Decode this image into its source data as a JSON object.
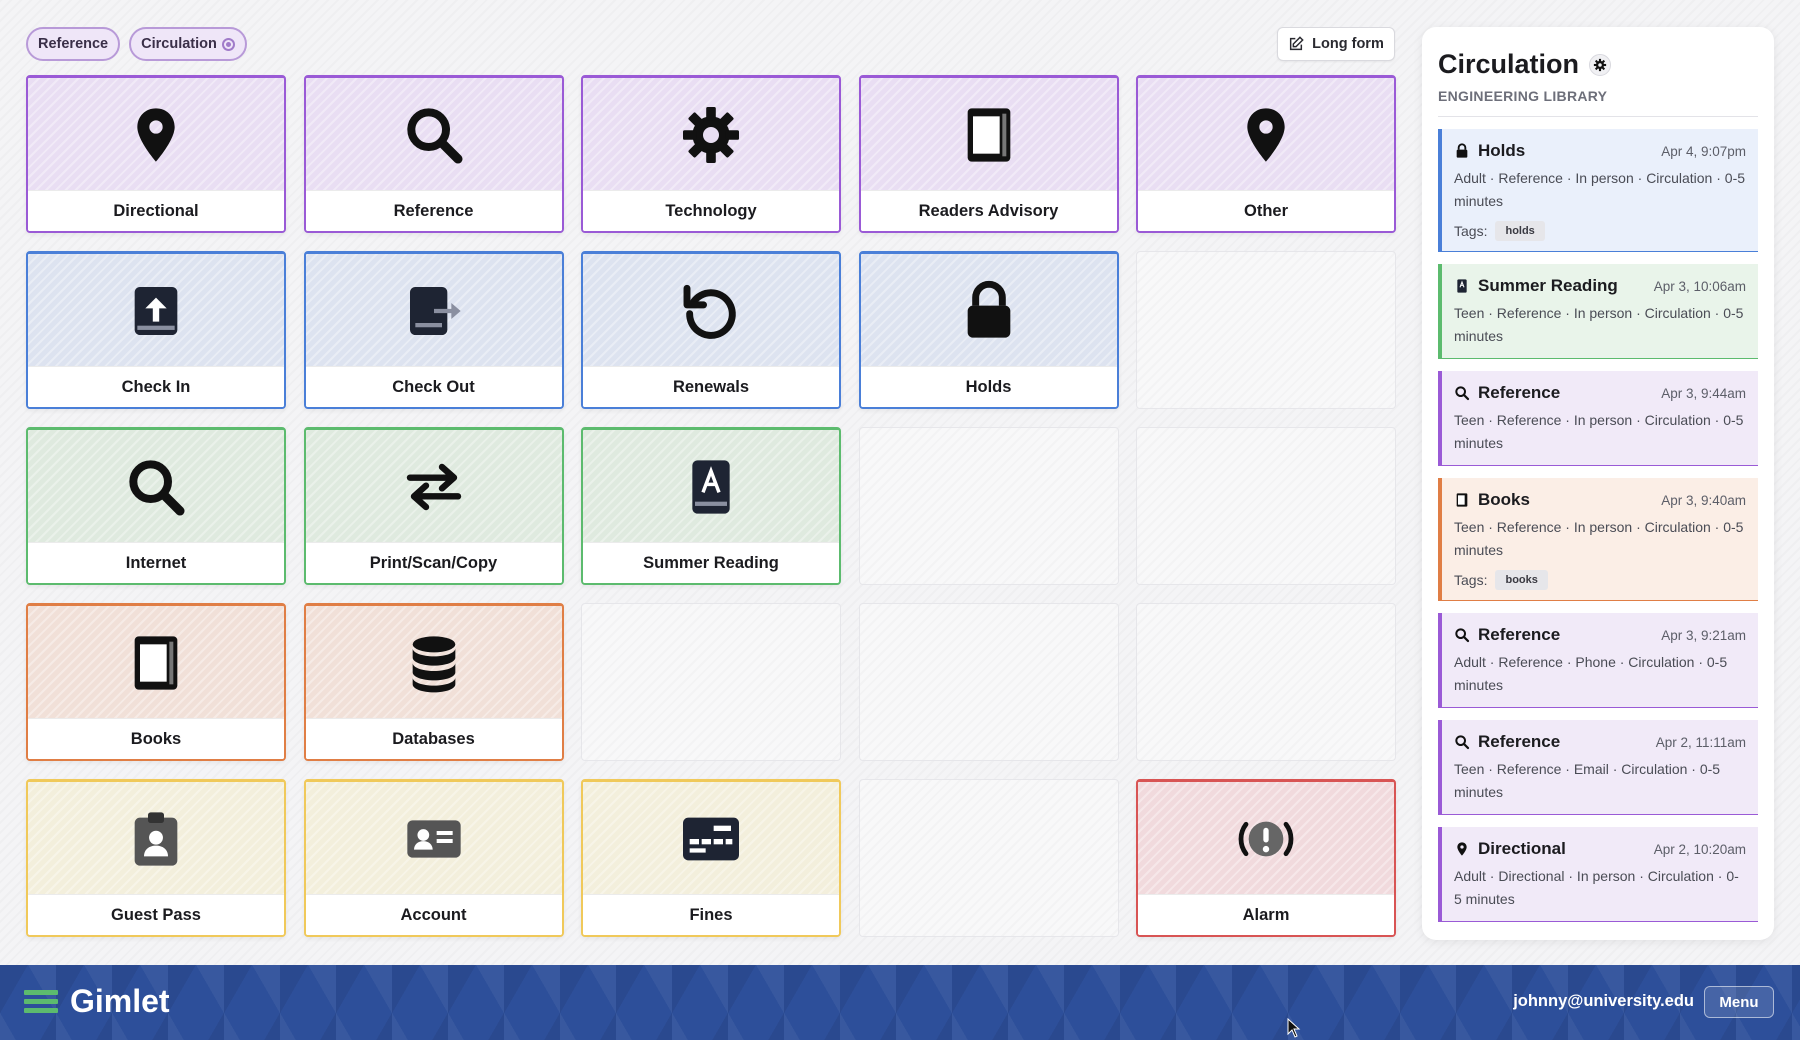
{
  "filters": {
    "chips": [
      "Reference",
      "Circulation"
    ]
  },
  "toolbar": {
    "long_form_label": "Long form"
  },
  "tiles": [
    {
      "label": "Directional",
      "icon": "map-pin-icon",
      "color": "purple"
    },
    {
      "label": "Reference",
      "icon": "search-icon",
      "color": "purple"
    },
    {
      "label": "Technology",
      "icon": "gear-icon",
      "color": "purple"
    },
    {
      "label": "Readers Advisory",
      "icon": "book-icon",
      "color": "purple"
    },
    {
      "label": "Other",
      "icon": "map-pin-icon",
      "color": "purple"
    },
    {
      "label": "Check In",
      "icon": "check-in-icon",
      "color": "blue"
    },
    {
      "label": "Check Out",
      "icon": "check-out-icon",
      "color": "blue"
    },
    {
      "label": "Renewals",
      "icon": "undo-icon",
      "color": "blue"
    },
    {
      "label": "Holds",
      "icon": "lock-icon",
      "color": "blue"
    },
    {
      "label": "Internet",
      "icon": "search-icon",
      "color": "green"
    },
    {
      "label": "Print/Scan/Copy",
      "icon": "swap-arrows-icon",
      "color": "green"
    },
    {
      "label": "Summer Reading",
      "icon": "summer-reading-book-icon",
      "color": "green"
    },
    {
      "label": "Books",
      "icon": "book-icon",
      "color": "orange"
    },
    {
      "label": "Databases",
      "icon": "database-icon",
      "color": "orange"
    },
    {
      "label": "Guest Pass",
      "icon": "id-badge-icon",
      "color": "yellow"
    },
    {
      "label": "Account",
      "icon": "id-card-icon",
      "color": "yellow"
    },
    {
      "label": "Fines",
      "icon": "credit-card-icon",
      "color": "yellow"
    },
    {
      "label": "Alarm",
      "icon": "alarm-icon",
      "color": "red"
    }
  ],
  "panel": {
    "title": "Circulation",
    "subtitle": "ENGINEERING LIBRARY",
    "tags_label": "Tags:",
    "entries": [
      {
        "name": "Holds",
        "time": "Apr 4, 9:07pm",
        "meta": "Adult · Reference · In person · Circulation · 0-5 minutes",
        "tag": "holds",
        "icon": "lock-icon",
        "color": "blue"
      },
      {
        "name": "Summer Reading",
        "time": "Apr 3, 10:06am",
        "meta": "Teen · Reference · In person · Circulation · 0-5 minutes",
        "tag": "",
        "icon": "summer-reading-book-icon",
        "color": "green"
      },
      {
        "name": "Reference",
        "time": "Apr 3, 9:44am",
        "meta": "Teen · Reference · In person · Circulation · 0-5 minutes",
        "tag": "",
        "icon": "search-icon",
        "color": "purple"
      },
      {
        "name": "Books",
        "time": "Apr 3, 9:40am",
        "meta": "Teen · Reference · In person · Circulation · 0-5 minutes",
        "tag": "books",
        "icon": "book-icon",
        "color": "orange"
      },
      {
        "name": "Reference",
        "time": "Apr 3, 9:21am",
        "meta": "Adult · Reference · Phone · Circulation · 0-5 minutes",
        "tag": "",
        "icon": "search-icon",
        "color": "purple"
      },
      {
        "name": "Reference",
        "time": "Apr 2, 11:11am",
        "meta": "Teen · Reference · Email · Circulation · 0-5 minutes",
        "tag": "",
        "icon": "search-icon",
        "color": "purple"
      },
      {
        "name": "Directional",
        "time": "Apr 2, 10:20am",
        "meta": "Adult · Directional · In person · Circulation · 0-5 minutes",
        "tag": "",
        "icon": "map-pin-icon",
        "color": "purple"
      }
    ]
  },
  "footer": {
    "brand": "Gimlet",
    "user_email": "johnny@university.edu",
    "menu_label": "Menu"
  },
  "colors": {
    "purple": "#9a5ad6",
    "blue": "#4a7fd8",
    "green": "#5cbb6e",
    "orange": "#e07e45",
    "yellow": "#f0c95a",
    "red": "#d85454",
    "footer": "#2d4f9a"
  }
}
